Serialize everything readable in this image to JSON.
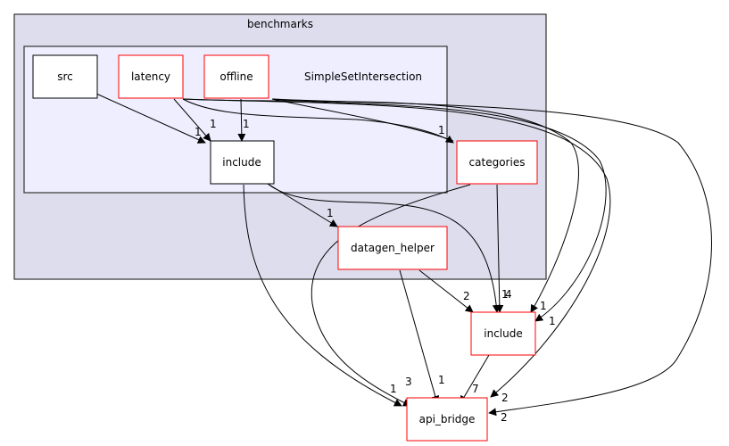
{
  "clusters": {
    "outer": {
      "label": "benchmarks"
    },
    "inner": {
      "label": "SimpleSetIntersection"
    }
  },
  "nodes": {
    "src": {
      "label": "src"
    },
    "latency": {
      "label": "latency"
    },
    "offline": {
      "label": "offline"
    },
    "include_inner": {
      "label": "include"
    },
    "categories": {
      "label": "categories"
    },
    "datagen_helper": {
      "label": "datagen_helper"
    },
    "include_outer": {
      "label": "include"
    },
    "api_bridge": {
      "label": "api_bridge"
    }
  },
  "edges": [
    {
      "from": "src",
      "to": "include_inner",
      "count": "1"
    },
    {
      "from": "latency",
      "to": "include_inner",
      "count": "1"
    },
    {
      "from": "offline",
      "to": "include_inner",
      "count": "1"
    },
    {
      "from": "latency",
      "to": "categories",
      "count": "1"
    },
    {
      "from": "include_inner",
      "to": "datagen_helper",
      "count": "1"
    },
    {
      "from": "include_inner",
      "to": "include_outer",
      "count": "1"
    },
    {
      "from": "categories",
      "to": "include_outer",
      "count": "4"
    },
    {
      "from": "datagen_helper",
      "to": "include_outer",
      "count": "2"
    },
    {
      "from": "latency",
      "to": "include_outer",
      "count": "1"
    },
    {
      "from": "offline",
      "to": "include_outer",
      "count": "1"
    },
    {
      "from": "include_inner",
      "to": "api_bridge",
      "count": "1"
    },
    {
      "from": "categories",
      "to": "api_bridge",
      "count": "3"
    },
    {
      "from": "datagen_helper",
      "to": "api_bridge",
      "count": "1"
    },
    {
      "from": "include_outer",
      "to": "api_bridge",
      "count": "7"
    },
    {
      "from": "latency",
      "to": "api_bridge",
      "count": "2"
    },
    {
      "from": "offline",
      "to": "api_bridge",
      "count": "2"
    }
  ],
  "colors": {
    "outer_fill": "#ddddee",
    "inner_fill": "#eeeeff",
    "cluster_border": "#404040",
    "node_red_border": "#ff0000",
    "node_black_border": "#000000"
  }
}
